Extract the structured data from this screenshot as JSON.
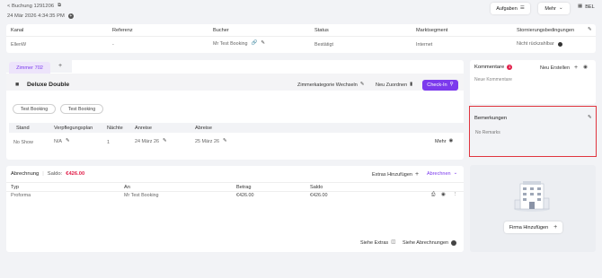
{
  "header": {
    "back_label": "< Buchung 1291206",
    "date_time": "24 Mär 2026 4:34:35 PM",
    "aufgaben_label": "Aufgaben",
    "mehr_label": "Mehr",
    "bel_label": "BEL"
  },
  "booking_info": {
    "columns": [
      "Kanal",
      "Referenz",
      "Bucher",
      "Status",
      "Marktsegment",
      "Stornierungsbedingungen"
    ],
    "values": [
      "EllenW",
      "-",
      "Mr Test Booking",
      "Bestätigt",
      "Internet",
      "Nicht rückzahlbar"
    ]
  },
  "room": {
    "tab_label": "Zimmer 702",
    "add_tab": "+",
    "room_type": "Deluxe Double",
    "change_category": "Zimmerkategorie Wechseln",
    "reassign": "Neu Zuordnen",
    "checkin": "Check-In",
    "guests": [
      "Test Booking",
      "Test Booking"
    ],
    "table_headers": [
      "Stand",
      "Verpflegungsplan",
      "Nächte",
      "Anreise",
      "Abreise"
    ],
    "row": {
      "stand": "No Show",
      "verpflegung": "N/A",
      "naechte": "1",
      "anreise": "24 März 26",
      "abreise": "25 März 26",
      "mehr": "Mehr"
    }
  },
  "billing": {
    "title": "Abrechnung",
    "saldo_label": "Saldo:",
    "saldo_value": "€426.00",
    "extras_add": "Extras Hinzufügen",
    "abrechnen": "Abrechnen",
    "headers": [
      "Typ",
      "An",
      "Betrag",
      "Saldo"
    ],
    "row": {
      "typ": "Proforma",
      "an": "Mr Test Booking",
      "betrag": "€426.00",
      "saldo": "€426.00"
    },
    "see_extras": "Siehe Extras",
    "see_billing": "Siehe Abrechnungen"
  },
  "comments": {
    "title": "Kommentare",
    "badge": "1",
    "create_new": "Neu Erstellen",
    "placeholder": "Neue Kommentare"
  },
  "remarks": {
    "title": "Bemerkungen",
    "empty": "No Remarks"
  },
  "company": {
    "add_label": "Firma Hinzufügen"
  },
  "colors": {
    "accent": "#7c3aed",
    "danger": "#e11d48",
    "highlight_border": "#e0343e"
  }
}
